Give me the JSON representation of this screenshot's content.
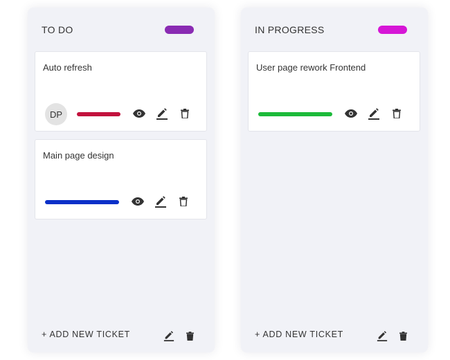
{
  "columns": [
    {
      "title": "TO DO",
      "pill_color": "#8a2bb3",
      "cards": [
        {
          "title": "Auto refresh",
          "avatar": "DP",
          "priority_color": "#c2123d"
        },
        {
          "title": "Main page design",
          "priority_color": "#0b30c8"
        }
      ],
      "add_label": "+ ADD NEW TICKET"
    },
    {
      "title": "IN PROGRESS",
      "pill_color": "#d616d6",
      "cards": [
        {
          "title": "User page rework Frontend",
          "priority_color": "#1cba3a"
        }
      ],
      "add_label": "+ ADD NEW TICKET"
    }
  ],
  "icons": {
    "view": "eye-icon",
    "edit": "pencil-icon",
    "delete": "trash-icon"
  }
}
